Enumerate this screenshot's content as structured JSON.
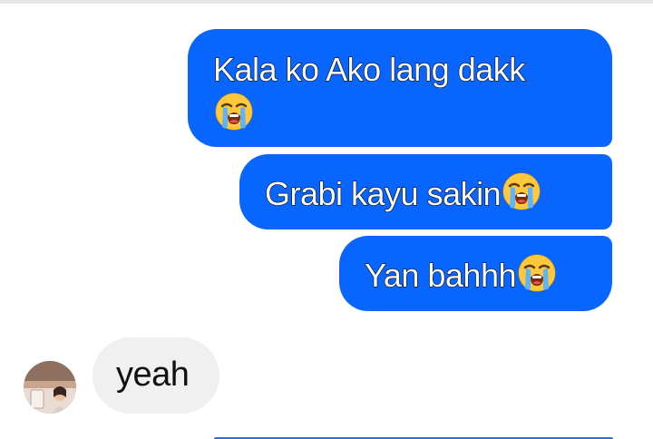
{
  "conversation": {
    "messages": [
      {
        "direction": "outgoing",
        "text": "Kala ko Ako lang dakk",
        "emoji": "loudly-crying-face"
      },
      {
        "direction": "outgoing",
        "text": "Grabi kayu sakin",
        "emoji": "loudly-crying-face"
      },
      {
        "direction": "outgoing",
        "text": "Yan bahhh",
        "emoji": "loudly-crying-face"
      },
      {
        "direction": "incoming",
        "text": "yeah",
        "emoji": ""
      }
    ]
  },
  "colors": {
    "outgoing_bubble": "#0866ff",
    "incoming_bubble": "#f0f0f0",
    "background": "#ffffff"
  }
}
